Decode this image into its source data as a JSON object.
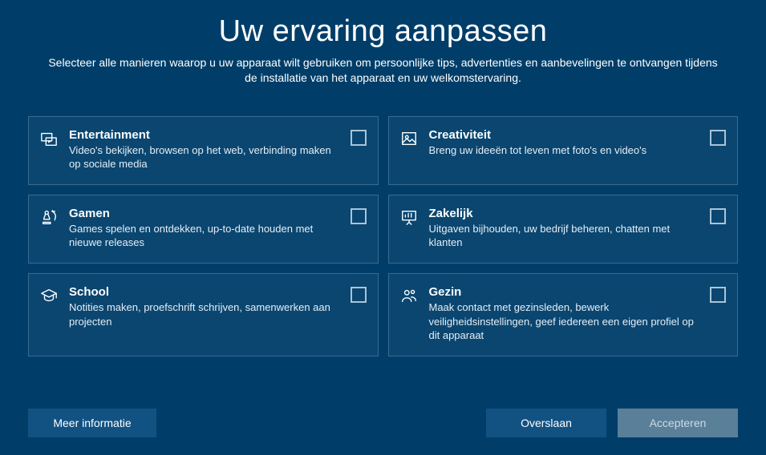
{
  "header": {
    "title": "Uw ervaring aanpassen",
    "subtitle": "Selecteer alle manieren waarop u uw apparaat wilt gebruiken om persoonlijke tips, advertenties en aanbevelingen te ontvangen tijdens de installatie van het apparaat en uw welkomstervaring."
  },
  "cards": {
    "entertainment": {
      "title": "Entertainment",
      "desc": "Video's bekijken, browsen op het web, verbinding maken op sociale media",
      "icon": "media-icon"
    },
    "creativity": {
      "title": "Creativiteit",
      "desc": "Breng uw ideeën tot leven met foto's en video's",
      "icon": "picture-icon"
    },
    "gaming": {
      "title": "Gamen",
      "desc": "Games spelen en ontdekken, up-to-date houden met nieuwe releases",
      "icon": "chess-icon"
    },
    "business": {
      "title": "Zakelijk",
      "desc": "Uitgaven bijhouden, uw bedrijf beheren, chatten met klanten",
      "icon": "presentation-icon"
    },
    "school": {
      "title": "School",
      "desc": "Notities maken, proefschrift schrijven, samenwerken aan projecten",
      "icon": "graduation-icon"
    },
    "family": {
      "title": "Gezin",
      "desc": "Maak contact met gezinsleden, bewerk veiligheidsinstellingen, geef iedereen een eigen profiel op dit apparaat",
      "icon": "people-icon"
    }
  },
  "footer": {
    "more": "Meer informatie",
    "skip": "Overslaan",
    "accept": "Accepteren"
  }
}
